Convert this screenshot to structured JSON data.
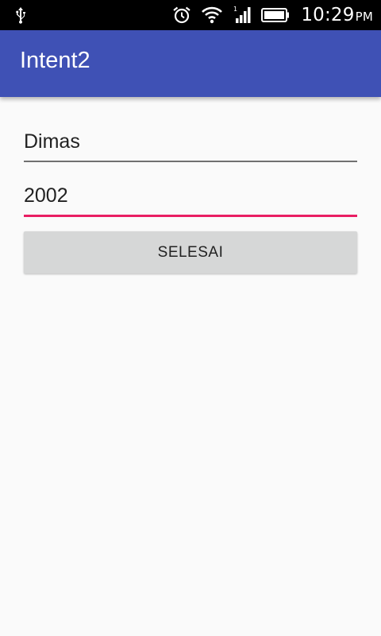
{
  "status_bar": {
    "time": "10:29",
    "ampm": "PM",
    "icons": [
      "usb-icon",
      "alarm-icon",
      "wifi-icon",
      "cellular-signal-icon",
      "battery-icon"
    ]
  },
  "app_bar": {
    "title": "Intent2",
    "color": "#3f51b5"
  },
  "form": {
    "name_value": "Dimas",
    "year_value": "2002",
    "accent_color": "#e91e63",
    "done_button_label": "SELESAI"
  }
}
